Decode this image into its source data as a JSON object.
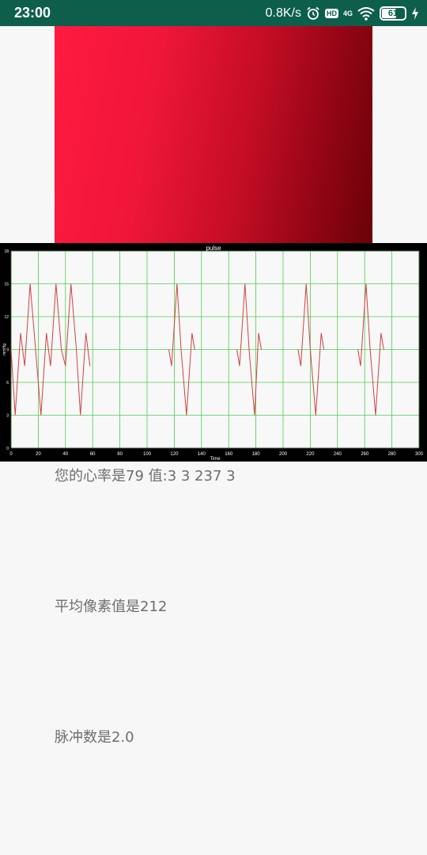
{
  "status_bar": {
    "time": "23:00",
    "speed": "0.8K/s",
    "hd": "HD",
    "network": "4G",
    "battery": "61",
    "battery_level": 0.61
  },
  "chart_data": {
    "type": "line",
    "title": "pulse",
    "xlabel": "Time",
    "ylabel": "mmHg",
    "xlim": [
      0,
      300
    ],
    "ylim": [
      0,
      18
    ],
    "x_ticks": [
      "0",
      "20",
      "40",
      "60",
      "80",
      "100",
      "120",
      "140",
      "160",
      "180",
      "200",
      "220",
      "240",
      "260",
      "280",
      "300"
    ],
    "y_ticks": [
      "0",
      "3",
      "6",
      "9",
      "12",
      "15",
      "18"
    ],
    "grid": true,
    "series": [
      {
        "color": "#d04040",
        "segments": [
          [
            [
              0,
              9
            ],
            [
              3,
              3
            ],
            [
              7,
              10.5
            ],
            [
              10,
              7.5
            ],
            [
              14,
              15
            ],
            [
              18,
              9
            ],
            [
              22,
              3
            ],
            [
              26,
              10.5
            ],
            [
              29,
              7.5
            ],
            [
              33,
              15
            ],
            [
              37,
              9
            ],
            [
              40,
              7.5
            ],
            [
              44,
              15
            ],
            [
              48,
              9
            ],
            [
              51,
              3
            ],
            [
              55,
              10.5
            ],
            [
              58,
              7.5
            ]
          ],
          [
            [
              116,
              9
            ],
            [
              118,
              7.5
            ],
            [
              122,
              15
            ],
            [
              125,
              9
            ],
            [
              129,
              3
            ],
            [
              133,
              10.5
            ],
            [
              135,
              9
            ]
          ],
          [
            [
              166,
              9
            ],
            [
              168,
              7.5
            ],
            [
              172,
              15
            ],
            [
              175,
              9
            ],
            [
              179,
              3
            ],
            [
              182,
              10.5
            ],
            [
              184,
              9
            ]
          ],
          [
            [
              211,
              9
            ],
            [
              213,
              7.5
            ],
            [
              217,
              15
            ],
            [
              220,
              9
            ],
            [
              224,
              3
            ],
            [
              228,
              10.5
            ],
            [
              230,
              9
            ]
          ],
          [
            [
              255,
              9
            ],
            [
              257,
              7.5
            ],
            [
              261,
              15
            ],
            [
              264,
              9
            ],
            [
              268,
              3
            ],
            [
              272,
              10.5
            ],
            [
              274,
              9
            ]
          ]
        ]
      }
    ]
  },
  "results": {
    "heart_rate_line": "您的心率是79  值:3    3    237    3",
    "avg_pixel_line": "平均像素值是212",
    "pulse_count_line": "脉冲数是2.0"
  },
  "colors": {
    "status_bar": "#0e5e4c",
    "grid": "#4ccf4c",
    "line": "#d04040",
    "text": "#6e6e6e"
  }
}
